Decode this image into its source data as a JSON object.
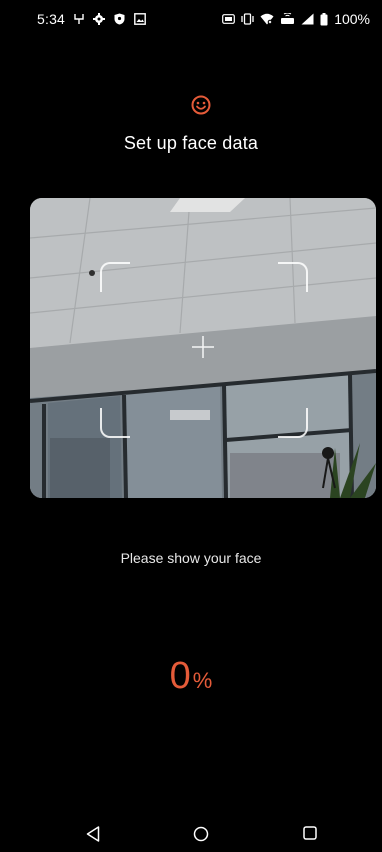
{
  "status_bar": {
    "time": "5:34",
    "battery_text": "100%",
    "left_icons": [
      "alarm-clock-icon",
      "settings-gear-icon",
      "shield-icon",
      "image-icon"
    ],
    "right_icons": [
      "nfc-icon",
      "vibrate-icon",
      "wifi-icon",
      "volte-icon",
      "signal-icon",
      "battery-icon"
    ]
  },
  "header": {
    "icon": "face-smile-icon",
    "title": "Set up face data",
    "accent_color": "#e55b39"
  },
  "camera": {
    "content": "live camera preview of an office ceiling and windows",
    "overlay": [
      "frame-corner-top-left",
      "frame-corner-top-right",
      "frame-corner-bottom-left",
      "frame-corner-bottom-right",
      "crosshair-icon"
    ]
  },
  "prompt": {
    "text": "Please show your face"
  },
  "progress": {
    "value": "0",
    "unit": "%"
  },
  "nav": {
    "back": "back-triangle-icon",
    "home": "home-circle-icon",
    "recents": "recents-square-icon"
  }
}
